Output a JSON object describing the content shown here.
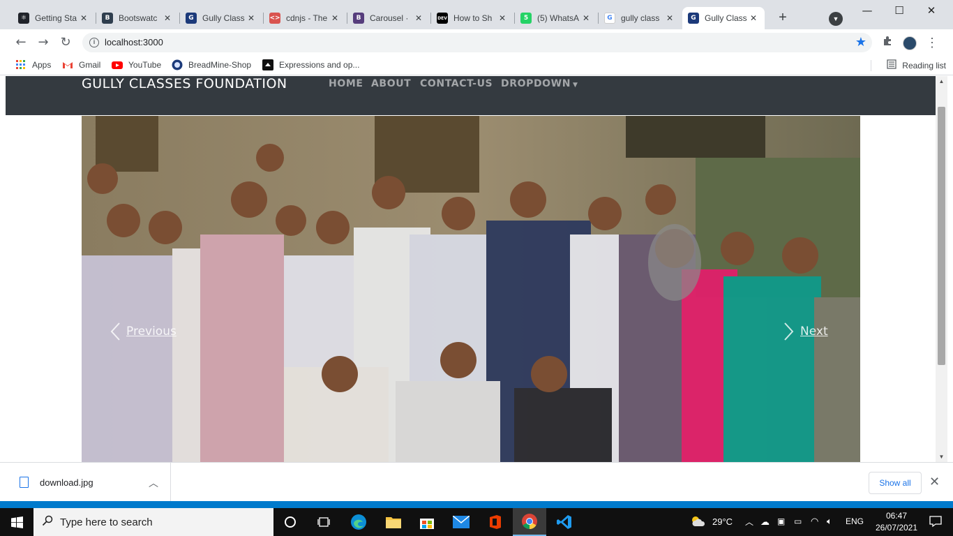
{
  "browser": {
    "tabs": [
      {
        "label": "Getting Sta",
        "fav_color": "#20232a",
        "fav_glyph": "⚛",
        "active": false
      },
      {
        "label": "Bootswatc",
        "fav_color": "#2f3e4e",
        "fav_glyph": "B",
        "active": false
      },
      {
        "label": "Gully Class",
        "fav_color": "#1c3a7a",
        "fav_glyph": "G",
        "active": false
      },
      {
        "label": "cdnjs - The",
        "fav_color": "#d9534f",
        "fav_glyph": "<>",
        "active": false
      },
      {
        "label": "Carousel ·",
        "fav_color": "#563d7c",
        "fav_glyph": "B",
        "active": false
      },
      {
        "label": "How to Sh",
        "fav_color": "#000000",
        "fav_glyph": "DEV",
        "active": false
      },
      {
        "label": "(5) WhatsA",
        "fav_color": "#25d366",
        "fav_glyph": "5",
        "active": false
      },
      {
        "label": "gully class",
        "fav_color": "#ffffff",
        "fav_glyph": "G",
        "active": false
      },
      {
        "label": "Gully Class",
        "fav_color": "#1c3a7a",
        "fav_glyph": "G",
        "active": true
      }
    ],
    "new_tab": "+",
    "url": "localhost:3000",
    "bookmarks": [
      {
        "label": "Apps",
        "icon": "apps-grid-icon"
      },
      {
        "label": "Gmail",
        "icon": "gmail-icon"
      },
      {
        "label": "YouTube",
        "icon": "youtube-icon"
      },
      {
        "label": "BreadMine-Shop",
        "icon": "site-icon"
      },
      {
        "label": "Expressions and op...",
        "icon": "site-icon"
      }
    ],
    "reading_list": "Reading list"
  },
  "site": {
    "brand": "GULLY CLASSES FOUNDATION",
    "nav": [
      "HOME",
      "ABOUT",
      "CONTACT-US",
      "DROPDOWN"
    ],
    "carousel": {
      "prev_label": "Previous",
      "next_label": "Next"
    }
  },
  "download": {
    "filename": "download.jpg",
    "show_all": "Show all"
  },
  "taskbar": {
    "search_placeholder": "Type here to search",
    "weather": "29°C",
    "language": "ENG",
    "time": "06:47",
    "date": "26/07/2021"
  },
  "colors": {
    "navbar_bg": "#343a40",
    "accent": "#1a73e8",
    "taskbar_bg": "#101010"
  }
}
